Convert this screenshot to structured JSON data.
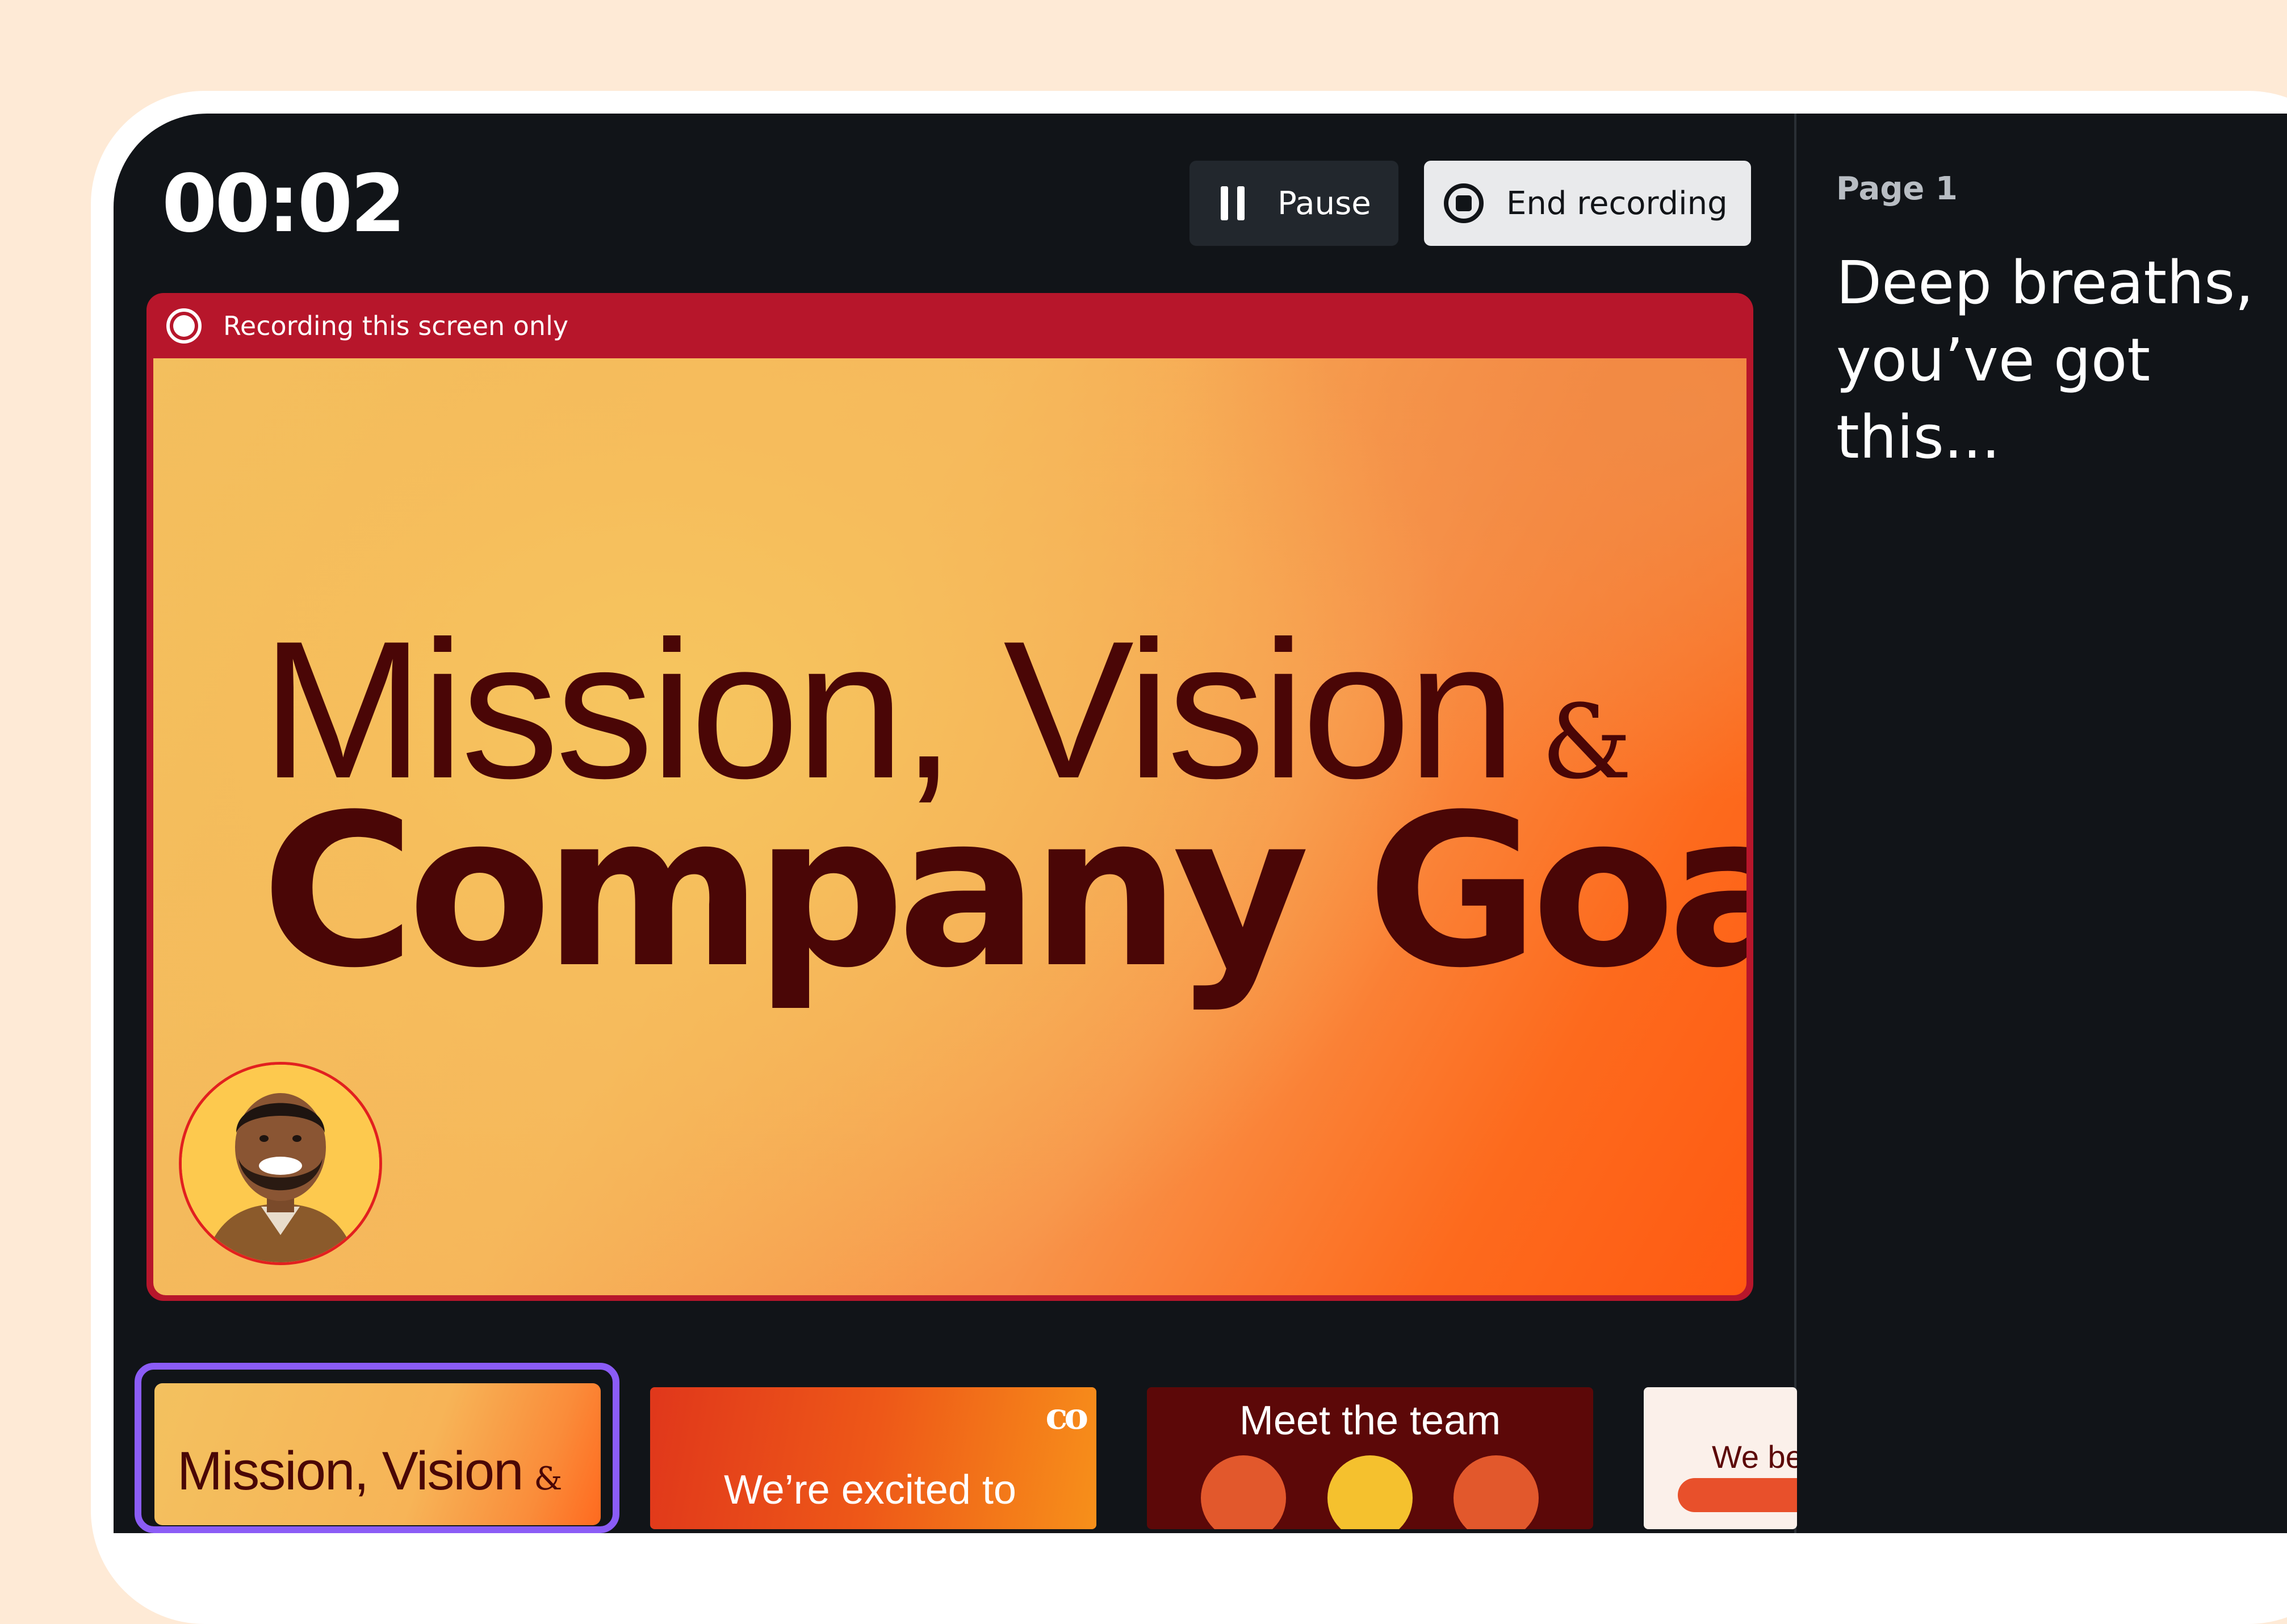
{
  "recorder": {
    "timer": "00:02",
    "pause_label": "Pause",
    "end_label": "End recording",
    "recording_notice": "Recording this screen only"
  },
  "slide": {
    "title_line1": "Mission, Vision",
    "title_amp": "&",
    "title_line2": "Company Goals"
  },
  "sidebar": {
    "page_label": "Page 1",
    "notes": "Deep breaths, you’ve got this..."
  },
  "thumbnails": [
    {
      "text": "Mission, Vision",
      "amp": "&"
    },
    {
      "text": "We’re excited to",
      "logo": "co"
    },
    {
      "text": "Meet the team"
    },
    {
      "text": "We be"
    }
  ],
  "colors": {
    "background": "#FEEAD6",
    "screen": "#111418",
    "recording_red": "#B7162B",
    "title_text": "#4A0606",
    "selection": "#8B5CF6"
  }
}
